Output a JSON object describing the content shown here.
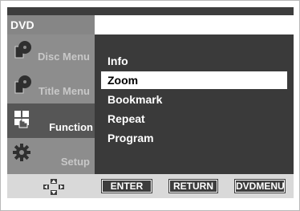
{
  "header": {
    "title": "DVD"
  },
  "sidebar": {
    "items": [
      {
        "label": "Disc Menu",
        "icon": "disc-menu-icon"
      },
      {
        "label": "Title Menu",
        "icon": "title-menu-icon"
      },
      {
        "label": "Function",
        "icon": "function-icon",
        "selected": true
      },
      {
        "label": "Setup",
        "icon": "setup-gear-icon"
      }
    ]
  },
  "menu": {
    "items": [
      {
        "label": "Info"
      },
      {
        "label": "Zoom",
        "active": true
      },
      {
        "label": "Bookmark"
      },
      {
        "label": "Repeat"
      },
      {
        "label": "Program"
      }
    ]
  },
  "footer": {
    "nav_icon": "dpad-icon",
    "enter_label": "ENTER",
    "return_label": "RETURN",
    "dvdmenu_label": "DVDMENU"
  },
  "colors": {
    "panel": "#3a3a3a",
    "sidebar": "#8d8d8d",
    "sidebar_selected": "#565656",
    "highlight": "#ffffff",
    "footer": "#d9d9d9"
  }
}
